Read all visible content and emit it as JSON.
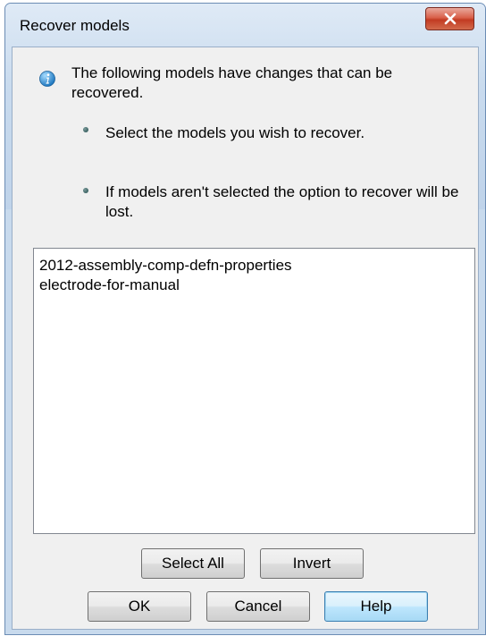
{
  "window": {
    "title": "Recover models",
    "close_icon": "close-icon"
  },
  "message": {
    "icon": "info-icon",
    "text": "The following models have changes that can be recovered.",
    "bullets": [
      "Select the models you wish to recover.",
      "If models aren't selected the option to recover will be lost."
    ]
  },
  "models": [
    "2012-assembly-comp-defn-properties",
    "electrode-for-manual"
  ],
  "buttons": {
    "select_all": "Select All",
    "invert": "Invert",
    "ok": "OK",
    "cancel": "Cancel",
    "help": "Help"
  },
  "colors": {
    "close_button": "#c94a31",
    "info_icon": "#2f8fd0",
    "default_button_border": "#3c7fb1"
  }
}
